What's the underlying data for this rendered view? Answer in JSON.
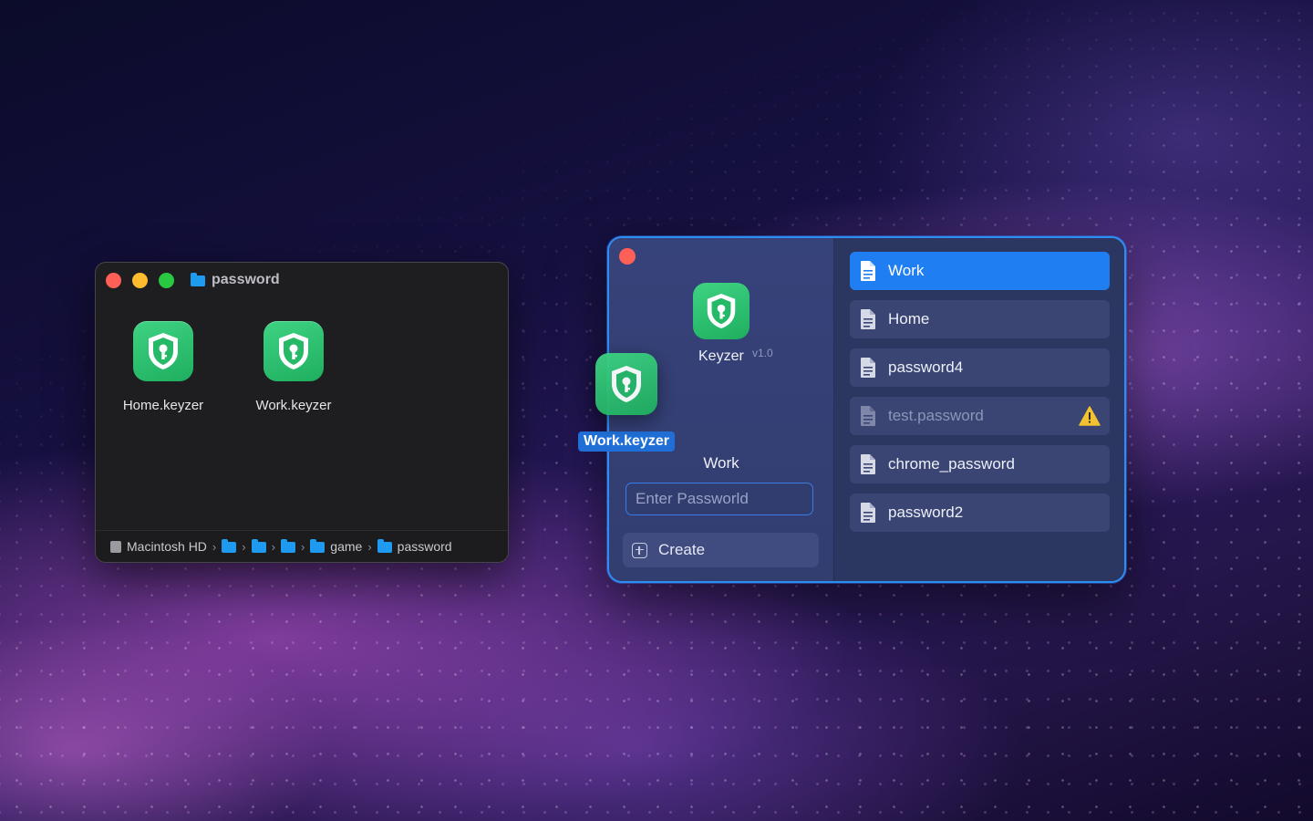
{
  "colors": {
    "accent": "#1f7ef2",
    "app_green": "#2fc170",
    "warning": "#f2c230"
  },
  "finder": {
    "title": "password",
    "files": [
      {
        "label": "Home.keyzer",
        "icon": "keyzer-shield-icon"
      },
      {
        "label": "Work.keyzer",
        "icon": "keyzer-shield-icon"
      }
    ],
    "path": {
      "disk": "Macintosh HD",
      "game": "game",
      "current": "password"
    }
  },
  "keyzer": {
    "app_name": "Keyzer",
    "version": "v1.0",
    "vault_name": "Work",
    "password_placeholder": "Enter Passworld",
    "create_label": "Create",
    "items": [
      {
        "label": "Work",
        "state": "selected"
      },
      {
        "label": "Home",
        "state": "normal"
      },
      {
        "label": "password4",
        "state": "normal"
      },
      {
        "label": "test.password",
        "state": "warning"
      },
      {
        "label": "chrome_password",
        "state": "normal"
      },
      {
        "label": "password2",
        "state": "normal"
      }
    ]
  },
  "drag": {
    "label": "Work.keyzer"
  }
}
